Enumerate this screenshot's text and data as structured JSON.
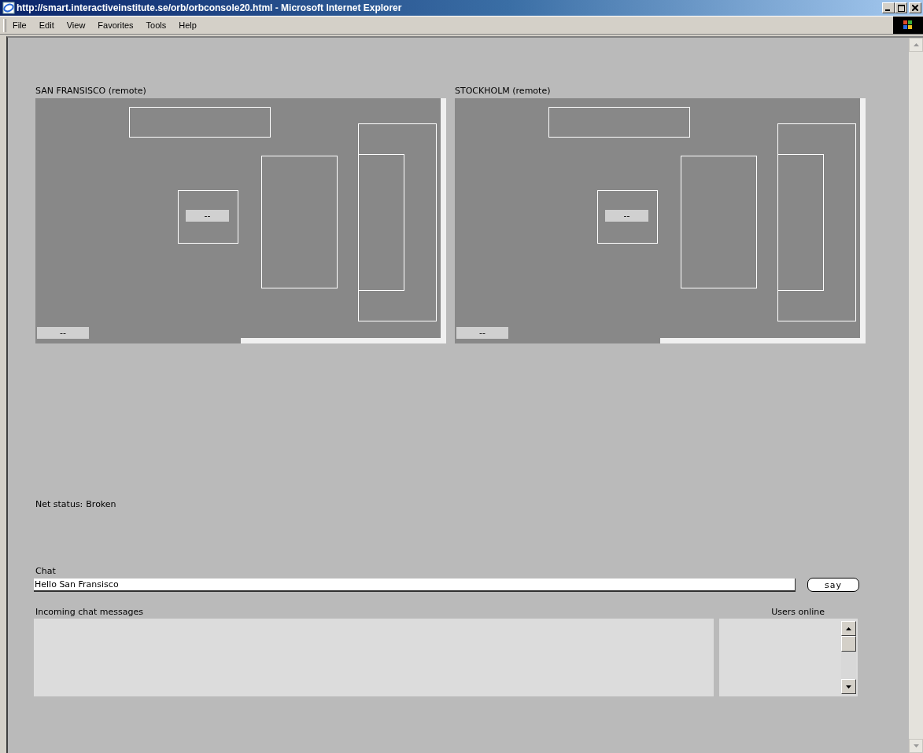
{
  "window": {
    "title": "http://smart.interactiveinstitute.se/orb/orbconsole20.html - Microsoft Internet Explorer"
  },
  "menu": [
    "File",
    "Edit",
    "View",
    "Favorites",
    "Tools",
    "Help"
  ],
  "rooms": [
    {
      "title": "SAN FRANSISCO (remote)",
      "center_label": "--",
      "corner_label": "--"
    },
    {
      "title": "STOCKHOLM (remote)",
      "center_label": "--",
      "corner_label": "--"
    }
  ],
  "net_status": {
    "label": "Net status:",
    "value": "Broken"
  },
  "chat": {
    "label": "Chat",
    "value": "Hello San Fransisco",
    "button": "say"
  },
  "incoming": {
    "label": "Incoming chat messages"
  },
  "users": {
    "label": "Users online"
  }
}
